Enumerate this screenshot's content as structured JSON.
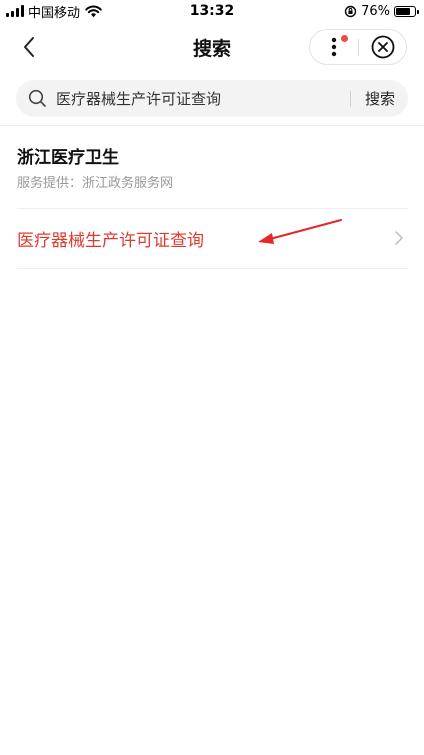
{
  "status_bar": {
    "carrier": "中国移动",
    "time": "13:32",
    "battery_percent": "76%",
    "battery_level": 0.76
  },
  "nav": {
    "title": "搜索",
    "back_icon": "chevron-left-icon",
    "more_icon": "more-vertical-icon",
    "close_icon": "close-circle-icon",
    "notification_dot_color": "#f04b40"
  },
  "search": {
    "value": "医疗器械生产许可证查询",
    "button_label": "搜索",
    "icon": "search-icon"
  },
  "results": {
    "provider": {
      "title": "浙江医疗卫生",
      "subtitle": "服务提供：浙江政务服务网"
    },
    "items": [
      {
        "label": "医疗器械生产许可证查询",
        "color": "#e03a2f"
      }
    ]
  },
  "colors": {
    "accent_red": "#e03a2f",
    "annotation_arrow": "#e8262a"
  }
}
